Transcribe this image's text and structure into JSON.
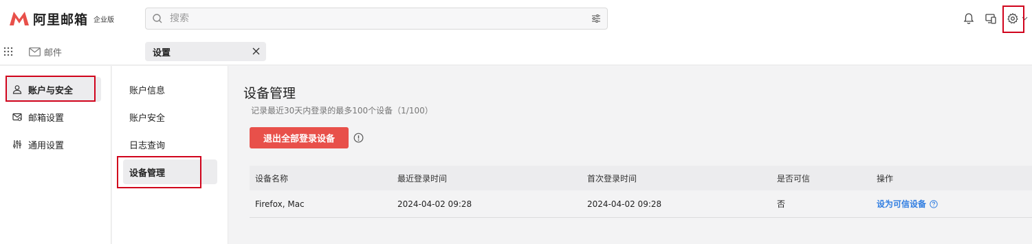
{
  "app": {
    "logo_text": "阿里邮箱",
    "edition_badge": "企业版",
    "brand_color": "#e8504a"
  },
  "search": {
    "placeholder": "搜索",
    "value": ""
  },
  "header_icons": [
    "bell-icon",
    "device-switch-icon",
    "gear-icon",
    "chevron-down-icon"
  ],
  "tabbar": {
    "mail_label": "邮件",
    "active_tab": "设置"
  },
  "primary_nav": {
    "items": [
      {
        "label": "账户与安全",
        "icon": "user-icon",
        "active": true
      },
      {
        "label": "邮箱设置",
        "icon": "mailbox-settings-icon",
        "active": false
      },
      {
        "label": "通用设置",
        "icon": "sliders-icon",
        "active": false
      }
    ]
  },
  "secondary_nav": {
    "items": [
      {
        "label": "账户信息",
        "active": false
      },
      {
        "label": "账户安全",
        "active": false
      },
      {
        "label": "日志查询",
        "active": false
      },
      {
        "label": "设备管理",
        "active": true
      }
    ]
  },
  "main": {
    "title": "设备管理",
    "subtitle": "记录最近30天内登录的最多100个设备（1/100）",
    "logout_all_button": "退出全部登录设备",
    "table": {
      "headers": [
        "设备名称",
        "最近登录时间",
        "首次登录时间",
        "是否可信",
        "操作"
      ],
      "rows": [
        {
          "device": "Firefox, Mac",
          "last_login": "2024-04-02 09:28",
          "first_login": "2024-04-02 09:28",
          "trusted": "否",
          "action": "设为可信设备"
        }
      ]
    }
  },
  "colors": {
    "highlight_outline": "#d0021b",
    "link": "#2f7de1"
  }
}
